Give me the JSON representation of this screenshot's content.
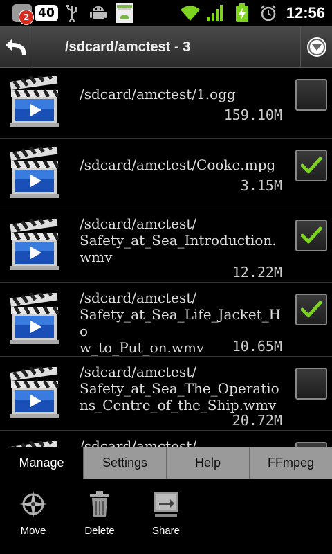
{
  "status_bar": {
    "notification_count": "2",
    "battery_pill": "40",
    "time": "12:56"
  },
  "title_bar": {
    "title": "/sdcard/amctest - 3"
  },
  "files": [
    {
      "name": "/sdcard/amctest/1.ogg",
      "size": "159.10M",
      "checked": false
    },
    {
      "name": "/sdcard/amctest/Cooke.mpg",
      "size": "3.15M",
      "checked": true
    },
    {
      "name": "/sdcard/amctest/\nSafety_at_Sea_Introduction.\nwmv",
      "size": "12.22M",
      "checked": true
    },
    {
      "name": "/sdcard/amctest/\nSafety_at_Sea_Life_Jacket_Ho\nw_to_Put_on.wmv",
      "size": "10.65M",
      "checked": true
    },
    {
      "name": "/sdcard/amctest/\nSafety_at_Sea_The_Operatio\nns_Centre_of_the_Ship.wmv",
      "size": "20.72M",
      "checked": false
    },
    {
      "name": "/sdcard/amctest/",
      "size": "",
      "checked": false
    }
  ],
  "menu": {
    "tabs": [
      "Manage",
      "Settings",
      "Help",
      "FFmpeg"
    ],
    "actions": {
      "move": "Move",
      "delete": "Delete",
      "share": "Share"
    }
  },
  "colors": {
    "check": "#7ed321",
    "tab_inactive": "#9a9a9a"
  }
}
